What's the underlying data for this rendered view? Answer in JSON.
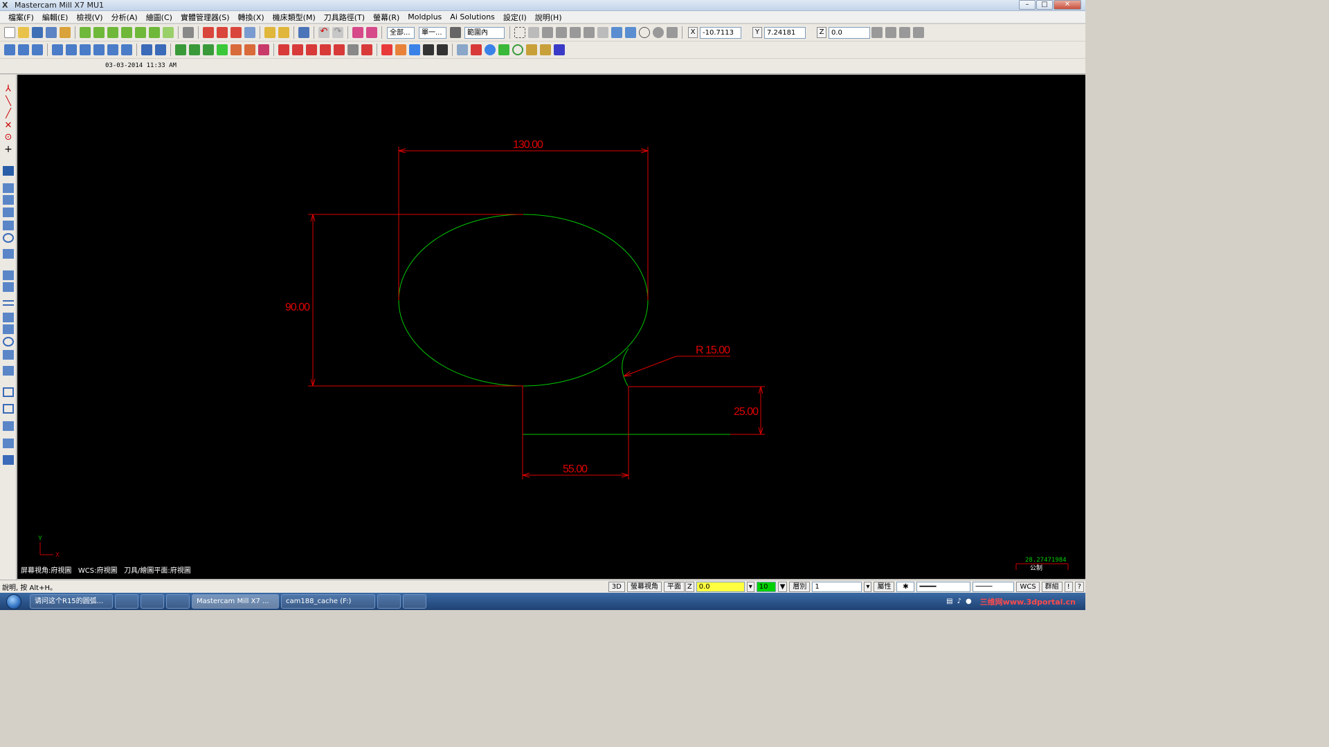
{
  "window": {
    "title": "Mastercam Mill X7 MU1",
    "minimize": "–",
    "maximize": "□",
    "close": "✕"
  },
  "menu": [
    "檔案(F)",
    "編輯(E)",
    "檢視(V)",
    "分析(A)",
    "繪圖(C)",
    "實體管理器(S)",
    "轉換(X)",
    "機床類型(M)",
    "刀具路徑(T)",
    "螢幕(R)",
    "Moldplus",
    "Ai Solutions",
    "設定(I)",
    "說明(H)"
  ],
  "toolbar1": {
    "select_all": "全部...",
    "select_single": "單一...",
    "range": "範圍內",
    "x_label": "X",
    "x_value": "-10.7113",
    "y_label": "Y",
    "y_value": "7.24181",
    "z_label": "Z",
    "z_value": "0.0"
  },
  "date_stamp": "03-03-2014 11:33 AM",
  "drawing": {
    "dimensions": {
      "width": "130.00",
      "height": "90.00",
      "radius": "R 15.00",
      "offset_y": "25.00",
      "offset_x": "55.00"
    },
    "geometry_color": "#00c800",
    "dimension_color": "#e00000"
  },
  "axis": {
    "y": "Y",
    "x": "X"
  },
  "view_info": {
    "screen_view": "屏幕視角:府視圖",
    "wcs": "WCS:府視圖",
    "tool_plane": "刀具/繪圖平面:府視圖"
  },
  "scale": {
    "value": "28.27471984",
    "unit": "公制"
  },
  "statusbar": {
    "help": "說明, 按 Alt+H。",
    "btn_3d": "3D",
    "btn_screen_view": "螢幕視角",
    "btn_plane": "平面",
    "z_label": "Z",
    "z_value": "0.0",
    "color_value": "10",
    "level_label": "層別",
    "level_value": "1",
    "attributes": "屬性",
    "wcs": "WCS",
    "group": "群組"
  },
  "taskbar": {
    "tasks": [
      {
        "label": "请问这个R15的圆弧...",
        "active": false
      },
      {
        "label": "",
        "active": false
      },
      {
        "label": "",
        "active": false
      },
      {
        "label": "",
        "active": false
      },
      {
        "label": "Mastercam Mill X7 ...",
        "active": true
      },
      {
        "label": "cam188_cache (F:)",
        "active": false
      },
      {
        "label": "",
        "active": false
      },
      {
        "label": "",
        "active": false
      }
    ],
    "watermark": "三维网www.3dportal.cn"
  }
}
